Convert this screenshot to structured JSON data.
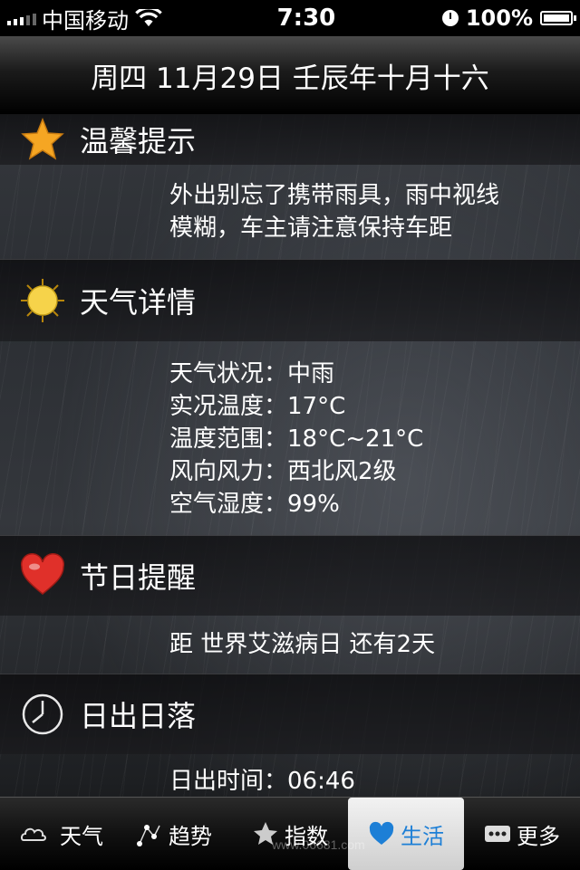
{
  "status_bar": {
    "carrier": "中国移动",
    "time": "7:30",
    "battery": "100%"
  },
  "date_line": "周四 11月29日 壬辰年十月十六",
  "sections": {
    "tips": {
      "title": "温馨提示",
      "icon": "star-icon",
      "text_line1": "外出别忘了携带雨具，雨中视线",
      "text_line2": "模糊，车主请注意保持车距"
    },
    "weather": {
      "title": "天气详情",
      "icon": "sun-icon",
      "rows": [
        {
          "key": "天气状况：",
          "value": "中雨"
        },
        {
          "key": "实况温度：",
          "value": "17°C"
        },
        {
          "key": "温度范围：",
          "value": "18°C~21°C"
        },
        {
          "key": "风向风力：",
          "value": "西北风2级"
        },
        {
          "key": "空气湿度：",
          "value": "99%"
        }
      ]
    },
    "holiday": {
      "title": "节日提醒",
      "icon": "heart-icon",
      "text": "距 世界艾滋病日 还有2天"
    },
    "sun": {
      "title": "日出日落",
      "icon": "clock-icon",
      "partial_row": "日出时间：06:46"
    }
  },
  "tabs": [
    {
      "label": "天气",
      "icon": "cloud-icon"
    },
    {
      "label": "趋势",
      "icon": "trend-icon"
    },
    {
      "label": "指数",
      "icon": "index-star-icon"
    },
    {
      "label": "生活",
      "icon": "life-icon"
    },
    {
      "label": "更多",
      "icon": "more-icon"
    }
  ],
  "active_tab": "生活",
  "watermark": "www.06681.com",
  "colors": {
    "active_tab_text": "#1d7fd6",
    "star": "#f5a623",
    "heart": "#e0302a"
  }
}
